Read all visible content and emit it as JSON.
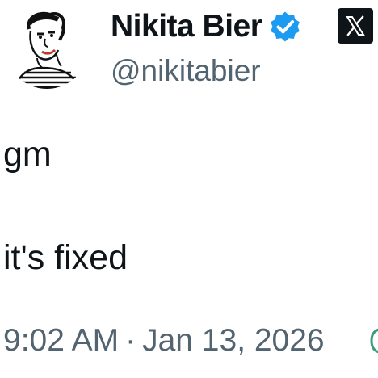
{
  "author": {
    "display_name": "Nikita Bier",
    "handle": "@nikitabier",
    "verified_color": "#1d9bf0"
  },
  "icons": {
    "avatar": "sketch-portrait-avatar",
    "verified": "verified-badge-icon",
    "brand": "x-logo-icon"
  },
  "tweet": {
    "lines": [
      "gm",
      "it's fixed"
    ]
  },
  "meta": {
    "time": "9:02 AM",
    "separator": "·",
    "date": "Jan 13, 2026"
  }
}
